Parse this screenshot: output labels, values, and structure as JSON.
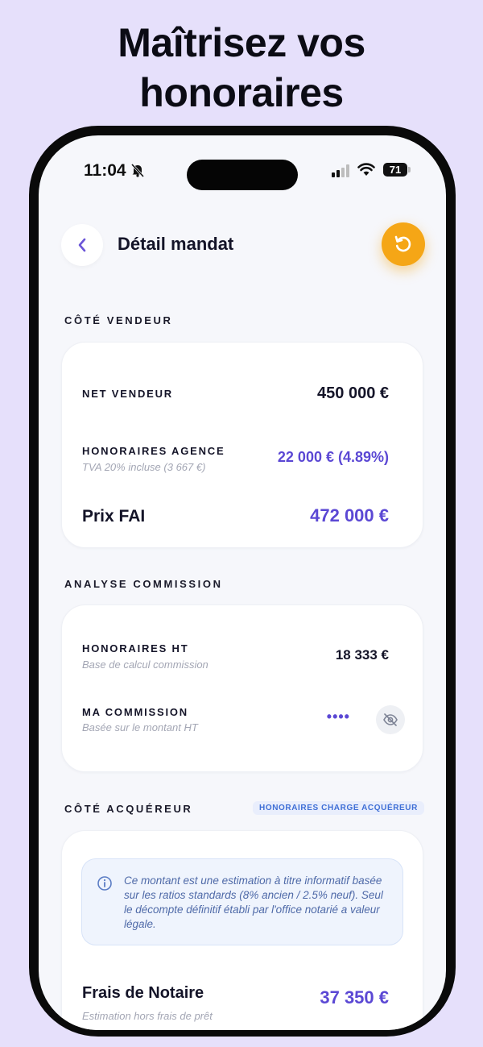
{
  "headline": {
    "line1": "Maîtrisez vos",
    "line2": "honoraires"
  },
  "status_bar": {
    "time": "11:04",
    "battery": "71"
  },
  "header": {
    "title": "Détail mandat"
  },
  "seller": {
    "section_label": "CÔTÉ VENDEUR",
    "net_label": "NET VENDEUR",
    "net_value": "450 000 €",
    "fees_label": "HONORAIRES AGENCE",
    "fees_sub": "TVA 20% incluse (3 667 €)",
    "fees_value": "22 000 € (4.89%)",
    "fai_label": "Prix FAI",
    "fai_value": "472 000 €"
  },
  "commission": {
    "section_label": "ANALYSE COMMISSION",
    "ht_label": "HONORAIRES HT",
    "ht_sub": "Base de calcul commission",
    "ht_value": "18 333 €",
    "my_label": "MA COMMISSION",
    "my_sub": "Basée sur le montant HT",
    "my_value": "••••"
  },
  "buyer": {
    "section_label": "CÔTÉ ACQUÉREUR",
    "badge": "HONORAIRES CHARGE ACQUÉREUR",
    "info": "Ce montant est une estimation à titre informatif basée sur les ratios standards (8% ancien / 2.5% neuf). Seul le décompte définitif établi par l'office notarié a valeur légale.",
    "notary_label": "Frais de Notaire",
    "notary_sub": "Estimation hors frais de prêt",
    "notary_value": "37 350 €"
  },
  "colors": {
    "accent": "#5b48d4",
    "orange": "#f5a616",
    "background": "#e6e0fb"
  }
}
